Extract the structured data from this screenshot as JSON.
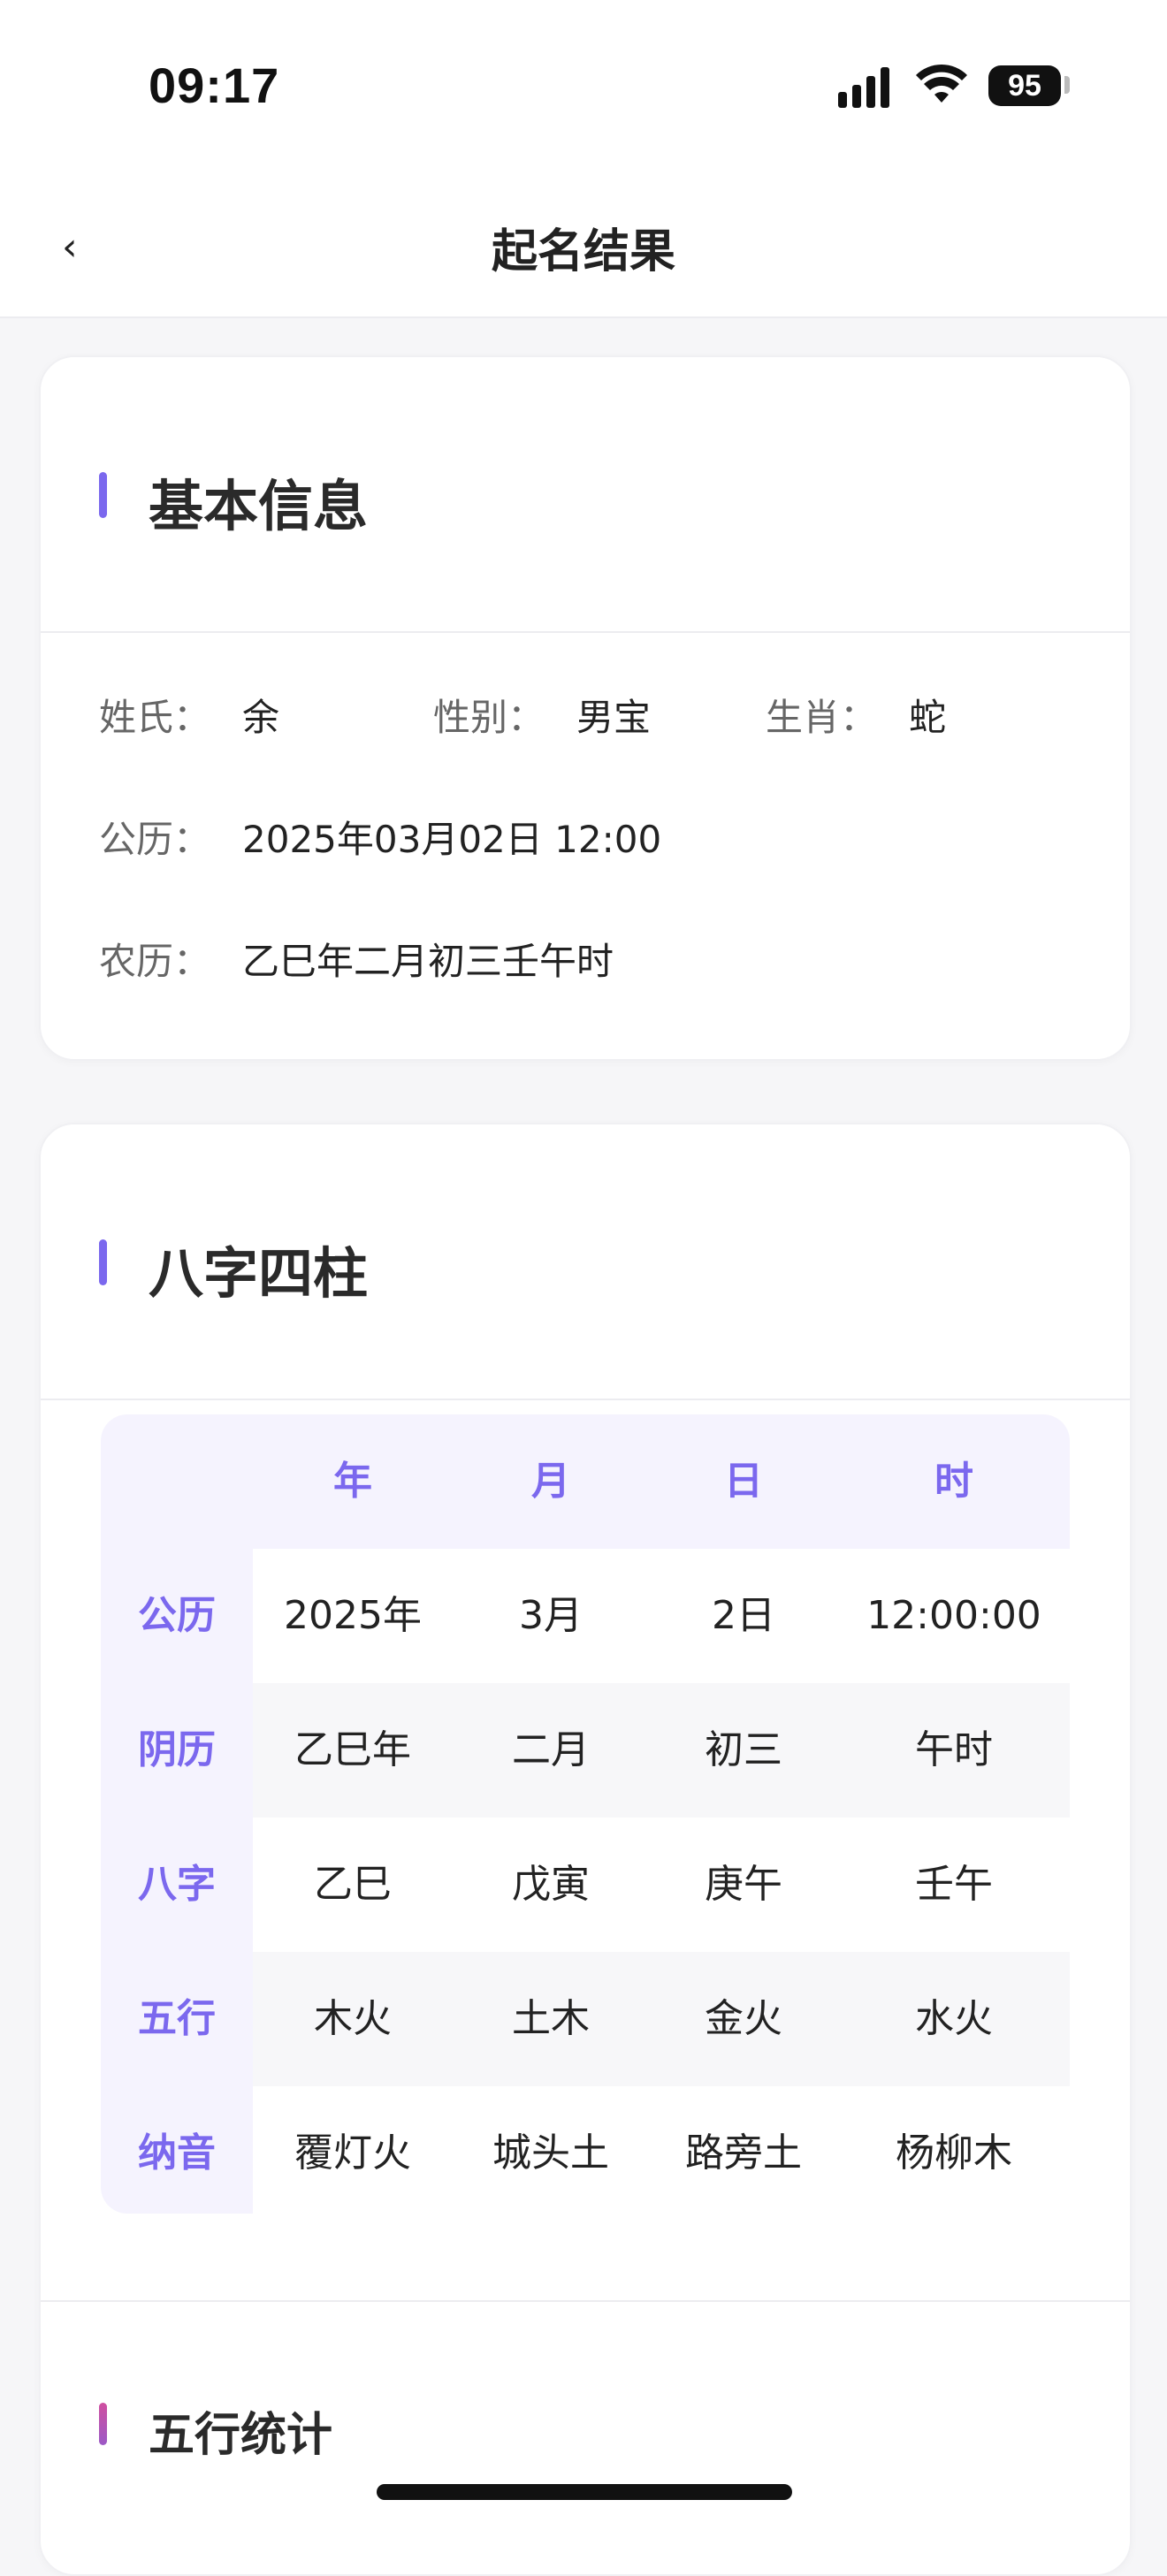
{
  "status_bar": {
    "time": "09:17",
    "battery": "95"
  },
  "nav": {
    "back_icon": "‹",
    "title": "起名结果"
  },
  "basic_info": {
    "title": "基本信息",
    "surname_label": "姓氏：",
    "surname": "余",
    "gender_label": "性别：",
    "gender": "男宝",
    "zodiac_label": "生肖：",
    "zodiac": "蛇",
    "solar_label": "公历：",
    "solar": "2025年03月02日 12:00",
    "lunar_label": "农历：",
    "lunar": "乙巳年二月初三壬午时"
  },
  "bazi": {
    "title": "八字四柱",
    "columns": [
      "年",
      "月",
      "日",
      "时"
    ],
    "rows": [
      {
        "label": "公历",
        "values": [
          "2025年",
          "3月",
          "2日",
          "12:00:00"
        ]
      },
      {
        "label": "阴历",
        "values": [
          "乙巳年",
          "二月",
          "初三",
          "午时"
        ]
      },
      {
        "label": "八字",
        "values": [
          "乙巳",
          "戊寅",
          "庚午",
          "壬午"
        ]
      },
      {
        "label": "五行",
        "values": [
          "木火",
          "土木",
          "金火",
          "水火"
        ]
      },
      {
        "label": "纳音",
        "values": [
          "覆灯火",
          "城头土",
          "路旁土",
          "杨柳木"
        ]
      }
    ]
  },
  "wuxing": {
    "title": "五行统计"
  },
  "colors": {
    "accent": "#7b68ee",
    "accent_pink": "#d04fa0"
  }
}
